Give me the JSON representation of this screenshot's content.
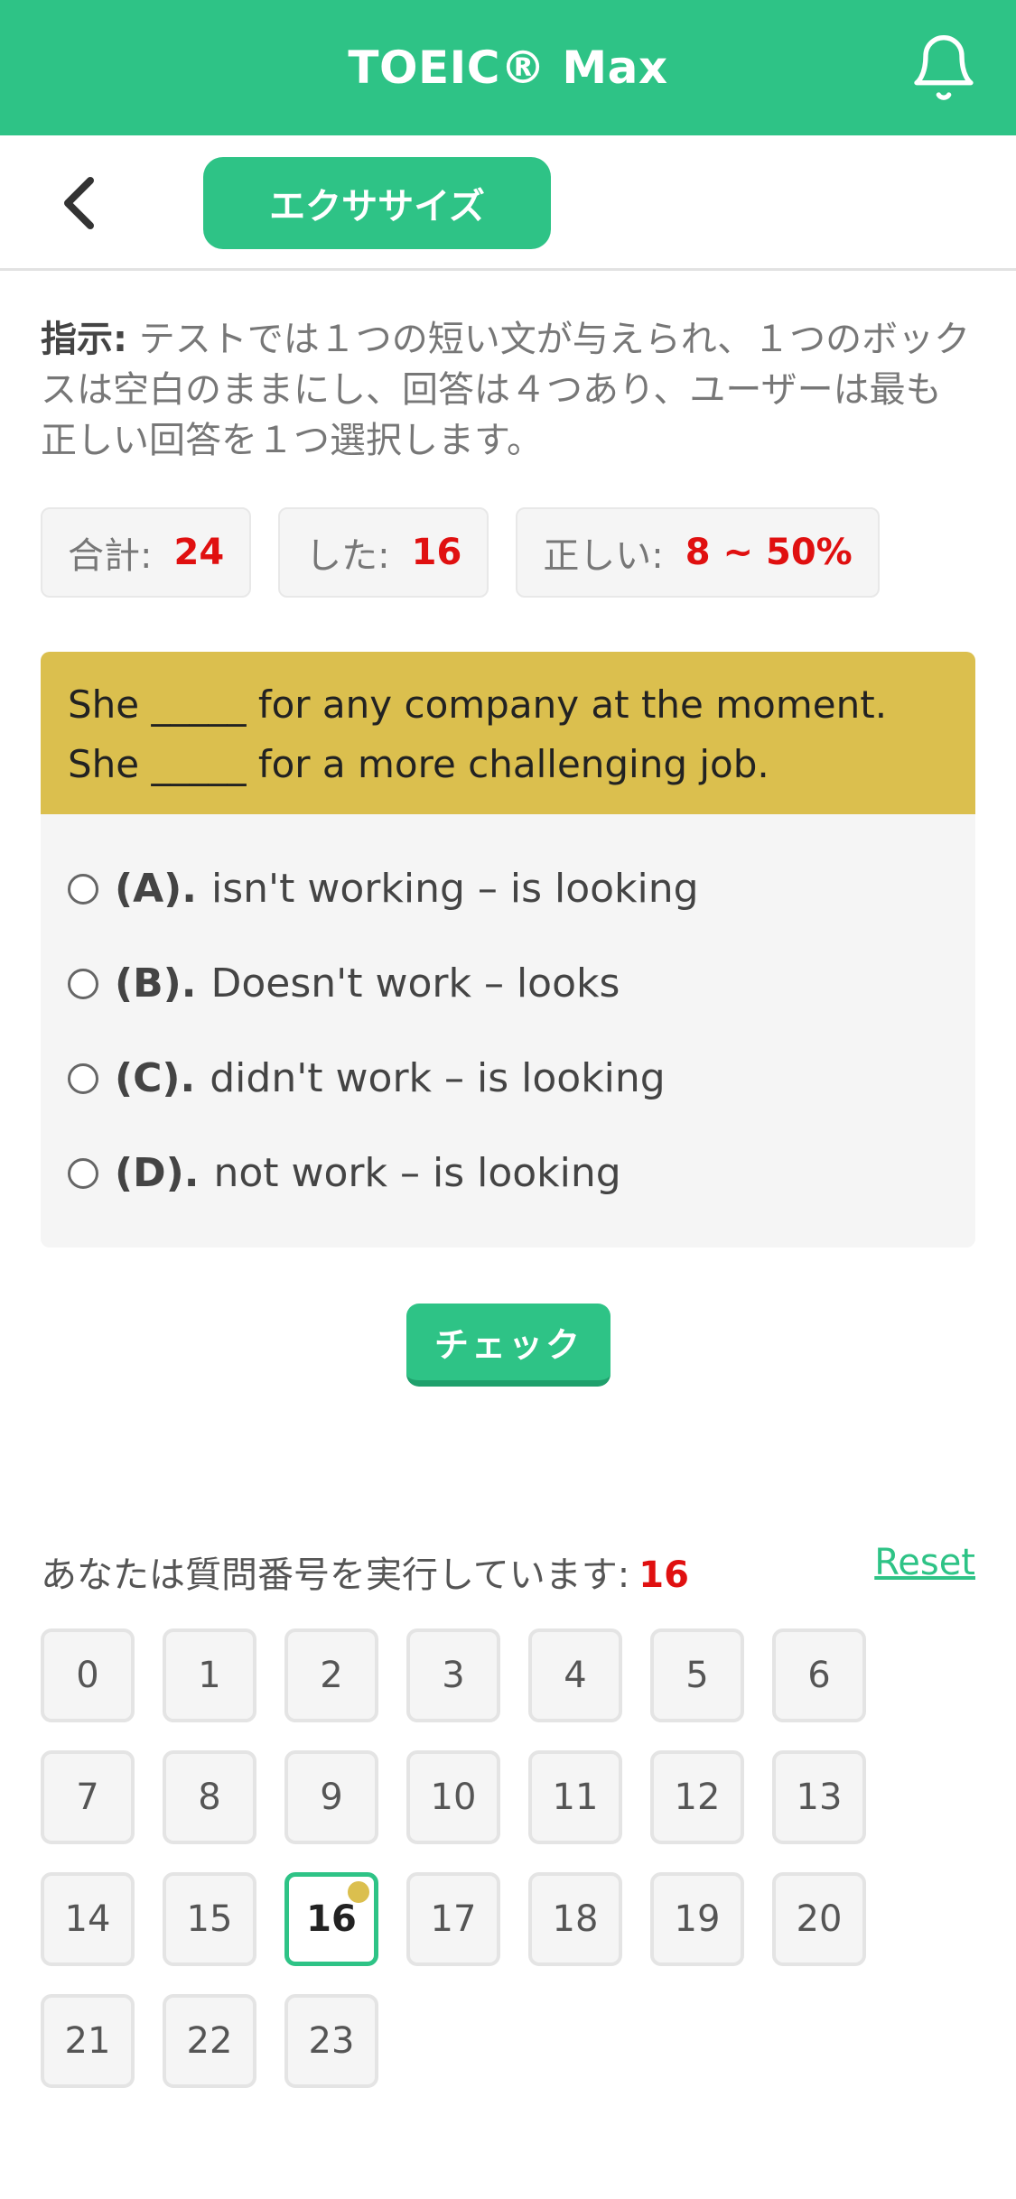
{
  "header": {
    "title": "TOEIC® Max"
  },
  "subnav": {
    "tab_label": "エクササイズ"
  },
  "instructions": {
    "label": "指示:",
    "text": " テストでは１つの短い文が与えられ、１つのボックスは空白のままにし、回答は４つあり、ユーザーは最も正しい回答を１つ選択します。"
  },
  "stats": [
    {
      "label": "合計:",
      "value": "24"
    },
    {
      "label": "した:",
      "value": "16"
    },
    {
      "label": "正しい:",
      "value": "8 ~ 50%"
    }
  ],
  "question": {
    "text": "She _____ for any company at the moment. She _____ for a more challenging job.",
    "options": [
      {
        "letter": "(A).",
        "text": "isn't working – is looking"
      },
      {
        "letter": "(B).",
        "text": "Doesn't work – looks"
      },
      {
        "letter": "(C).",
        "text": "didn't work – is looking"
      },
      {
        "letter": "(D).",
        "text": "not work – is looking"
      }
    ]
  },
  "check_button": {
    "label": "チェック"
  },
  "progress": {
    "label": "あなたは質問番号を実行しています:",
    "current": "16",
    "reset_label": "Reset"
  },
  "question_numbers": [
    "0",
    "1",
    "2",
    "3",
    "4",
    "5",
    "6",
    "7",
    "8",
    "9",
    "10",
    "11",
    "12",
    "13",
    "14",
    "15",
    "16",
    "17",
    "18",
    "19",
    "20",
    "21",
    "22",
    "23"
  ],
  "active_question": "16",
  "colors": {
    "brand": "#2ec386",
    "question_bg": "#dbbf4e",
    "accent_red": "#e01010"
  }
}
